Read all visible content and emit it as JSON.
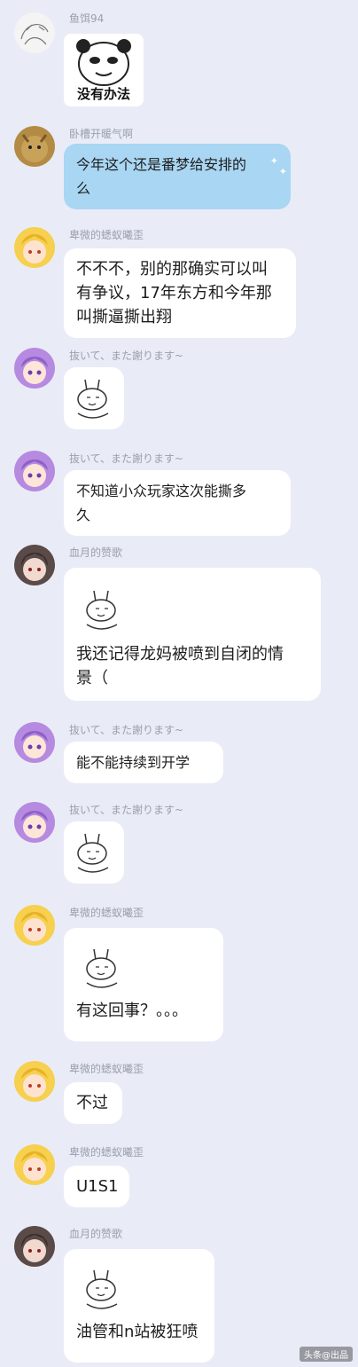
{
  "colors": {
    "background": "#e9ecf7",
    "bubble": "#ffffff",
    "bubble_highlight": "#a9d6f3",
    "sender_name": "#9aa0ad"
  },
  "messages": [
    {
      "sender": "鱼饵94",
      "avatar": "sketch-avatar",
      "type": "sticker",
      "sticker": "panda-meme",
      "caption": "没有办法"
    },
    {
      "sender": "卧槽开暖气啊",
      "avatar": "cat-avatar",
      "type": "text",
      "style": "highlight",
      "lines": [
        "今年这个还是番梦给安排的",
        "么"
      ]
    },
    {
      "sender": "卑微的蟋蚁曦歪",
      "avatar": "blonde-girl-avatar",
      "type": "text",
      "lines": [
        "不不不，别的那确实可以叫",
        "有争议，17年东方和今年那",
        "叫撕逼撕出翔"
      ]
    },
    {
      "sender": "抜いて、また謝ります~",
      "avatar": "purple-hair-avatar",
      "type": "sticker",
      "sticker": "bunny-meme"
    },
    {
      "sender": "抜いて、また謝ります~",
      "avatar": "purple-hair-avatar",
      "type": "text",
      "style": "handwritten",
      "lines": [
        "不知道小众玩家这次能撕多",
        "久"
      ]
    },
    {
      "sender": "血月的赞歌",
      "avatar": "dark-hair-avatar",
      "type": "sticker-text",
      "sticker": "bunny-meme",
      "lines": [
        "我还记得龙妈被喷到自闭的情",
        "景（"
      ]
    },
    {
      "sender": "抜いて、また謝ります~",
      "avatar": "purple-hair-avatar",
      "type": "text",
      "style": "handwritten",
      "lines": [
        "能不能持续到开学"
      ]
    },
    {
      "sender": "抜いて、また謝ります~",
      "avatar": "purple-hair-avatar",
      "type": "sticker",
      "sticker": "bunny-meme"
    },
    {
      "sender": "卑微的蟋蚁曦歪",
      "avatar": "blonde-girl-avatar",
      "type": "sticker-text",
      "sticker": "bunny-meme",
      "lines": [
        "有这回事？。。。"
      ]
    },
    {
      "sender": "卑微的蟋蚁曦歪",
      "avatar": "blonde-girl-avatar",
      "type": "text",
      "lines": [
        "不过"
      ]
    },
    {
      "sender": "卑微的蟋蚁曦歪",
      "avatar": "blonde-girl-avatar",
      "type": "text",
      "lines": [
        "U1S1"
      ]
    },
    {
      "sender": "血月的赞歌",
      "avatar": "dark-hair-avatar",
      "type": "sticker-text",
      "sticker": "bunny-meme",
      "lines": [
        "油管和n站被狂喷"
      ]
    }
  ],
  "watermark": "头条@出品"
}
